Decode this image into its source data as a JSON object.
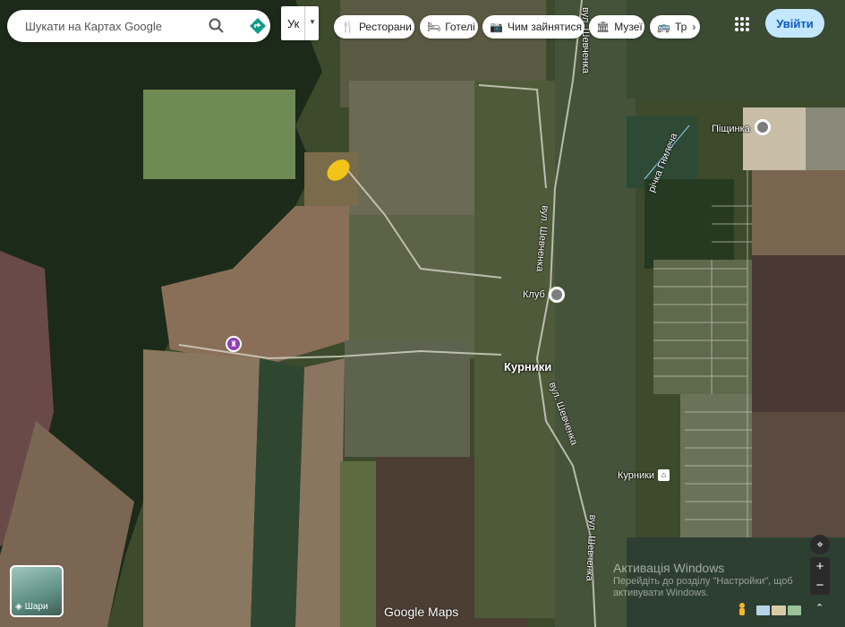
{
  "search": {
    "placeholder": "Шукати на Картах Google"
  },
  "language": {
    "label": "Ук"
  },
  "chips": [
    {
      "label": "Ресторани",
      "icon": "fork-knife-icon"
    },
    {
      "label": "Готелі",
      "icon": "bed-icon"
    },
    {
      "label": "Чим зайнятися",
      "icon": "camera-icon"
    },
    {
      "label": "Музеї",
      "icon": "museum-icon"
    },
    {
      "label": "Тр",
      "icon": "transit-icon"
    }
  ],
  "signin": {
    "label": "Увійти"
  },
  "layers": {
    "label": "Шари"
  },
  "places": {
    "town": "Курники",
    "club": "Клуб",
    "station": "Курники",
    "sandpit": "Піщинка"
  },
  "roads": {
    "shevchenka_1": "вул. Шевченка",
    "shevchenka_2": "вул. Шевченка",
    "shevchenka_3": "вул. Шевченка",
    "shevchenka_4": "вул. Шевченка",
    "river": "річка Гнилеча"
  },
  "footer": {
    "logo": "Google Maps"
  },
  "watermark": {
    "title": "Активація Windows",
    "text": "Перейдіть до розділу \"Настройки\", щоб активувати Windows."
  },
  "colors": {
    "accent": "#0b57d0",
    "signin_bg": "#c2e7ff",
    "highlight": "#f2c318",
    "poi_purple": "#8e3fb8"
  }
}
